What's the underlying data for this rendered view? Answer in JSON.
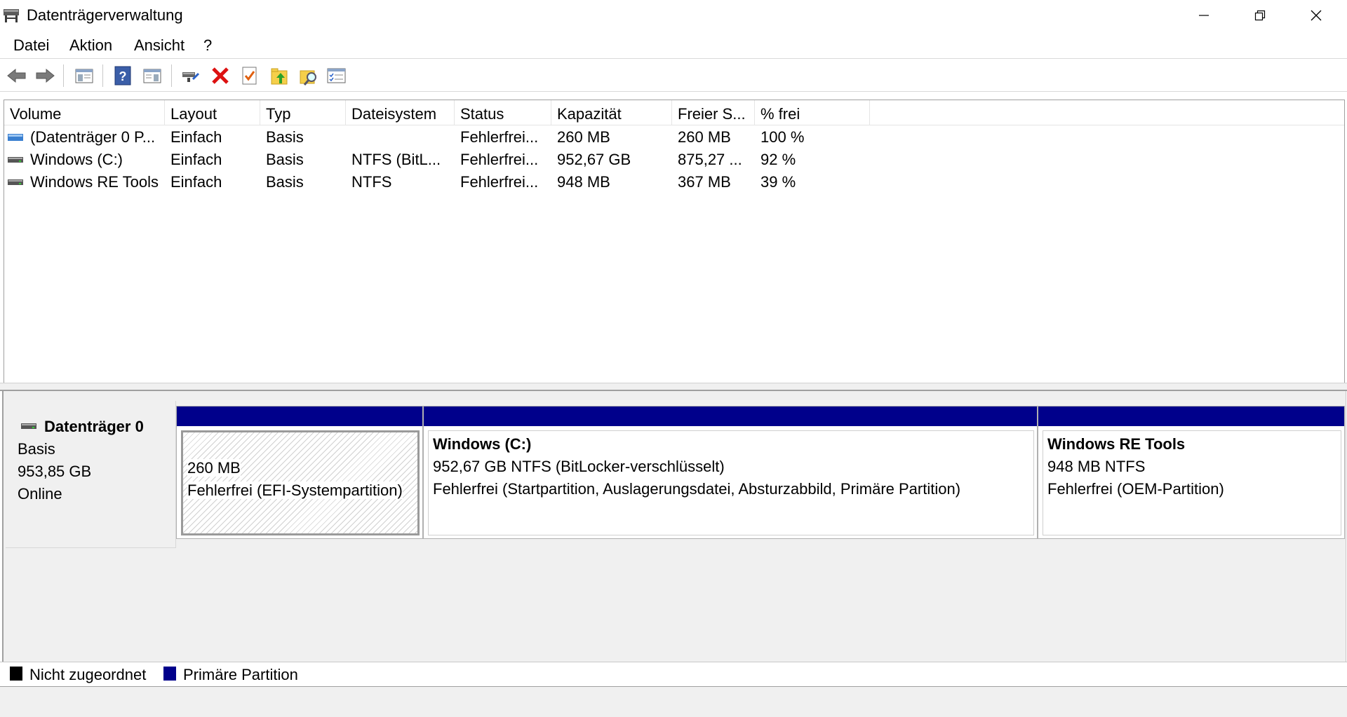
{
  "window": {
    "title": "Datenträgerverwaltung",
    "controls": {
      "minimize": "minimize",
      "restore": "restore",
      "close": "close"
    }
  },
  "menu": {
    "items": [
      "Datei",
      "Aktion",
      "Ansicht",
      "?"
    ]
  },
  "toolbar": {
    "buttons": [
      "back-icon",
      "forward-icon",
      "show-hide-console-tree-icon",
      "help-icon",
      "show-hide-action-pane-icon",
      "connect-icon",
      "delete-icon",
      "properties-icon",
      "up-level-icon",
      "search-icon",
      "settings-icon"
    ]
  },
  "volume_list": {
    "columns": [
      "Volume",
      "Layout",
      "Typ",
      "Dateisystem",
      "Status",
      "Kapazität",
      "Freier S...",
      "% frei"
    ],
    "rows": [
      {
        "volume": "(Datenträger 0 P...",
        "layout": "Einfach",
        "typ": "Basis",
        "dateisystem": "",
        "status": "Fehlerfrei...",
        "kapazitaet": "260 MB",
        "frei": "260 MB",
        "prozent": "100 %",
        "icon": "efi-volume-icon"
      },
      {
        "volume": "Windows  (C:)",
        "layout": "Einfach",
        "typ": "Basis",
        "dateisystem": "NTFS (BitL...",
        "status": "Fehlerfrei...",
        "kapazitaet": "952,67 GB",
        "frei": "875,27 ...",
        "prozent": "92 %",
        "icon": "drive-icon"
      },
      {
        "volume": "Windows RE Tools",
        "layout": "Einfach",
        "typ": "Basis",
        "dateisystem": "NTFS",
        "status": "Fehlerfrei...",
        "kapazitaet": "948 MB",
        "frei": "367 MB",
        "prozent": "39 %",
        "icon": "drive-icon"
      }
    ]
  },
  "disk": {
    "name": "Datenträger 0",
    "type": "Basis",
    "size": "953,85 GB",
    "state": "Online",
    "partitions": [
      {
        "title": "",
        "size_line": "260 MB",
        "status_line": "Fehlerfrei (EFI-Systempartition)",
        "kind": "efi"
      },
      {
        "title": "Windows   (C:)",
        "size_line": "952,67 GB NTFS (BitLocker-verschlüsselt)",
        "status_line": "Fehlerfrei (Startpartition, Auslagerungsdatei, Absturzabbild, Primäre Partition)",
        "kind": "primary"
      },
      {
        "title": "Windows RE Tools",
        "size_line": "948 MB NTFS",
        "status_line": "Fehlerfrei (OEM-Partition)",
        "kind": "primary"
      }
    ]
  },
  "legend": {
    "unallocated": "Nicht zugeordnet",
    "primary": "Primäre Partition",
    "unallocated_color": "#000000",
    "primary_color": "#00008b"
  }
}
